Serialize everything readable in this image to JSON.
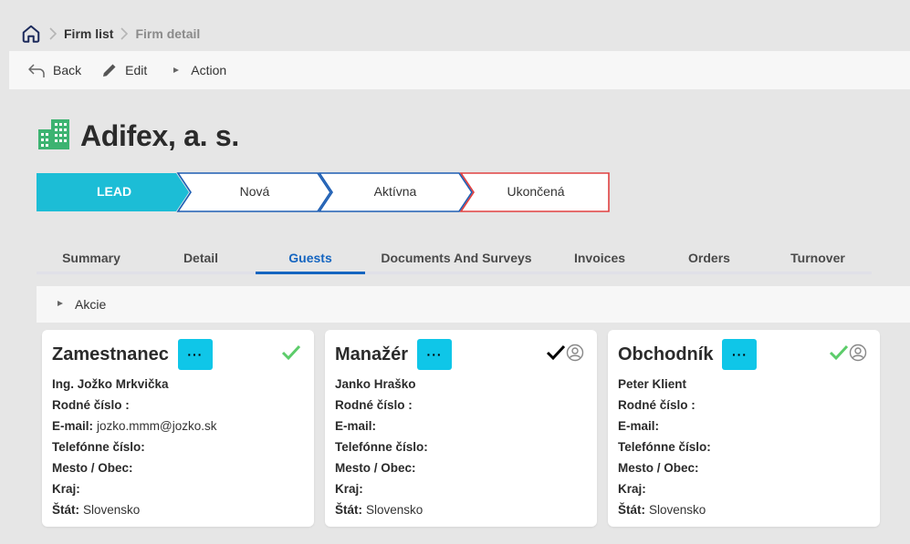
{
  "breadcrumb": {
    "home_icon": "home-icon",
    "items": [
      {
        "label": "Firm list"
      },
      {
        "label": "Firm detail"
      }
    ]
  },
  "toolbar": {
    "back_label": "Back",
    "edit_label": "Edit",
    "action_label": "Action"
  },
  "page": {
    "title": "Adifex, a. s.",
    "icon": "building-icon",
    "accent": "#3cb371"
  },
  "stages": [
    {
      "label": "LEAD",
      "state": "active",
      "color": "#1cbdd6"
    },
    {
      "label": "Nová",
      "state": "default",
      "color": "#1e5fb4"
    },
    {
      "label": "Aktívna",
      "state": "default",
      "color": "#1e5fb4"
    },
    {
      "label": "Ukončená",
      "state": "closed",
      "color": "#e04040"
    }
  ],
  "tabs": [
    {
      "label": "Summary"
    },
    {
      "label": "Detail"
    },
    {
      "label": "Guests",
      "active": true
    },
    {
      "label": "Documents And Surveys"
    },
    {
      "label": "Invoices"
    },
    {
      "label": "Orders"
    },
    {
      "label": "Turnover"
    }
  ],
  "actions_bar": {
    "label": "Akcie"
  },
  "labels": {
    "rodne_cislo": "Rodné číslo :",
    "email": "E-mail:",
    "telefon": "Telefónne číslo:",
    "mesto": "Mesto / Obec:",
    "kraj": "Kraj:",
    "stat": "Štát:",
    "menu_button": "···"
  },
  "cards": [
    {
      "role": "Zamestnanec",
      "name": "Ing. Jožko Mrkvička",
      "rodne_cislo": "",
      "email": "jozko.mmm@jozko.sk",
      "telefon": "",
      "mesto": "",
      "kraj": "",
      "stat": "Slovensko",
      "check_color": "#5ccc6a",
      "user_icon": false
    },
    {
      "role": "Manažér",
      "name": "Janko Hraško",
      "rodne_cislo": "",
      "email": "",
      "telefon": "",
      "mesto": "",
      "kraj": "",
      "stat": "Slovensko",
      "check_color": "#000000",
      "user_icon": true
    },
    {
      "role": "Obchodník",
      "name": "Peter Klient",
      "rodne_cislo": "",
      "email": "",
      "telefon": "",
      "mesto": "",
      "kraj": "",
      "stat": "Slovensko",
      "check_color": "#5ccc6a",
      "user_icon": true
    }
  ]
}
